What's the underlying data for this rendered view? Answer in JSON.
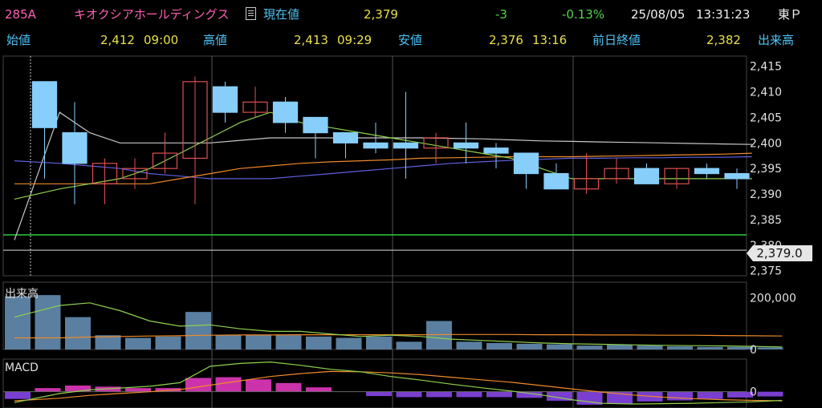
{
  "header": {
    "code": "285A",
    "company": "キオクシアホールディングス",
    "current_label": "現在値",
    "current": "2,379",
    "change": "-3",
    "change_pct": "-0.13%",
    "date": "25/08/05",
    "time": "13:31:23",
    "exchange": "東Ｐ",
    "open_label": "始値",
    "open": "2,412",
    "open_time": "09:00",
    "high_label": "高値",
    "high": "2,413",
    "high_time": "09:29",
    "low_label": "安値",
    "low": "2,376",
    "low_time": "13:16",
    "prev_label": "前日終値",
    "prev": "2,382",
    "volume_label": "出来高"
  },
  "colors": {
    "up": "#e05050",
    "down": "#87cefa",
    "ma_short": "#8fd14f",
    "ma_mid": "#f08a2a",
    "ma_long": "#6060e0",
    "ma_vlong": "#c8c8c8",
    "prev_close": "#2ecc40",
    "volume_bar": "#5a7fa0",
    "macd_pos": "#cc33aa",
    "macd_neg": "#7a3fd0"
  },
  "chart_data": {
    "type": "candlestick",
    "price_label": "2,379.0",
    "ylim": [
      2374,
      2417
    ],
    "price_ticks": [
      {
        "v": 2415,
        "label": "2,415"
      },
      {
        "v": 2410,
        "label": "2,410"
      },
      {
        "v": 2405,
        "label": "2,405"
      },
      {
        "v": 2400,
        "label": "2,400"
      },
      {
        "v": 2395,
        "label": "2,395"
      },
      {
        "v": 2390,
        "label": "2,390"
      },
      {
        "v": 2385,
        "label": "2,385"
      },
      {
        "v": 2380,
        "label": "2,380"
      },
      {
        "v": 2375,
        "label": "2,375"
      }
    ],
    "prev_close": 2382,
    "candles": [
      {
        "o": 2412,
        "h": 2412,
        "l": 2393,
        "c": 2403
      },
      {
        "o": 2402,
        "h": 2408,
        "l": 2388,
        "c": 2396
      },
      {
        "o": 2392,
        "h": 2397,
        "l": 2388,
        "c": 2396
      },
      {
        "o": 2393,
        "h": 2397,
        "l": 2391,
        "c": 2395
      },
      {
        "o": 2395,
        "h": 2402,
        "l": 2394,
        "c": 2398
      },
      {
        "o": 2397,
        "h": 2413,
        "l": 2388,
        "c": 2412
      },
      {
        "o": 2411,
        "h": 2412,
        "l": 2404,
        "c": 2406
      },
      {
        "o": 2406,
        "h": 2411,
        "l": 2405,
        "c": 2408
      },
      {
        "o": 2408,
        "h": 2409,
        "l": 2402,
        "c": 2404
      },
      {
        "o": 2405,
        "h": 2405,
        "l": 2397,
        "c": 2402
      },
      {
        "o": 2402,
        "h": 2402,
        "l": 2397,
        "c": 2400
      },
      {
        "o": 2400,
        "h": 2404,
        "l": 2398,
        "c": 2399
      },
      {
        "o": 2400,
        "h": 2410,
        "l": 2393,
        "c": 2399
      },
      {
        "o": 2399,
        "h": 2402,
        "l": 2396,
        "c": 2401
      },
      {
        "o": 2400,
        "h": 2404,
        "l": 2396,
        "c": 2399
      },
      {
        "o": 2399,
        "h": 2400,
        "l": 2395,
        "c": 2398
      },
      {
        "o": 2398,
        "h": 2398,
        "l": 2391,
        "c": 2394
      },
      {
        "o": 2394,
        "h": 2396,
        "l": 2391,
        "c": 2391
      },
      {
        "o": 2391,
        "h": 2398,
        "l": 2390,
        "c": 2393
      },
      {
        "o": 2393,
        "h": 2397,
        "l": 2392,
        "c": 2395
      },
      {
        "o": 2395,
        "h": 2396,
        "l": 2392,
        "c": 2392
      },
      {
        "o": 2392,
        "h": 2395,
        "l": 2391,
        "c": 2395
      },
      {
        "o": 2395,
        "h": 2396,
        "l": 2393,
        "c": 2394
      },
      {
        "o": 2394,
        "h": 2395,
        "l": 2391,
        "c": 2393
      }
    ],
    "ma_short": [
      2389,
      2391,
      2392,
      2393,
      2395,
      2398,
      2401,
      2404,
      2406,
      2404,
      2403,
      2402,
      2401,
      2400,
      2399,
      2398,
      2397,
      2395,
      2393,
      2393,
      2393,
      2393,
      2393,
      2393,
      2393
    ],
    "ma_mid": [
      2392,
      2392,
      2392,
      2392,
      2392,
      2393,
      2394,
      2395,
      2395.5,
      2396,
      2396.3,
      2396.5,
      2396.7,
      2397,
      2397.1,
      2397.2,
      2397.3,
      2397.3,
      2397.3,
      2397.4,
      2397.5,
      2397.6,
      2397.7,
      2397.8,
      2398
    ],
    "ma_long": [
      2396.5,
      2396,
      2395.5,
      2395,
      2394,
      2393.5,
      2393,
      2393,
      2393,
      2393.5,
      2394,
      2394.5,
      2395,
      2395.5,
      2396,
      2396.3,
      2396.6,
      2396.8,
      2397,
      2397,
      2397.1,
      2397.1,
      2397.2,
      2397.2,
      2397.3
    ],
    "ma_vlong": [
      2381,
      2406,
      2402,
      2400,
      2400,
      2400,
      2400,
      2400.5,
      2401,
      2401,
      2401,
      2401,
      2401,
      2401,
      2400.9,
      2400.8,
      2400.6,
      2400.4,
      2400.3,
      2400.2,
      2400.1,
      2400,
      2399.9,
      2399.8,
      2399.7
    ],
    "volume_ticks": [
      {
        "v": 200000,
        "label": "200,000"
      },
      {
        "v": 0,
        "label": "0"
      }
    ],
    "volume_label": "出来高",
    "volume_max": 260000,
    "volume": [
      205000,
      210000,
      125000,
      55000,
      45000,
      50000,
      145000,
      55000,
      55000,
      55000,
      50000,
      45000,
      50000,
      30000,
      110000,
      30000,
      25000,
      22000,
      20000,
      15000,
      18000,
      15000,
      12000,
      10000,
      10000,
      8000
    ],
    "vol_ma_short": [
      125000,
      170000,
      180000,
      150000,
      110000,
      90000,
      95000,
      80000,
      70000,
      70000,
      60000,
      50000,
      55000,
      50000,
      40000,
      35000,
      30000,
      25000,
      22000,
      20000,
      18000,
      16000,
      15000,
      14000,
      12000,
      10000
    ],
    "vol_ma_long": [
      45000,
      45000,
      48000,
      50000,
      52000,
      53000,
      55000,
      56000,
      56000,
      57000,
      57000,
      57000,
      57000,
      57000,
      58000,
      58000,
      58000,
      57000,
      57000,
      56000,
      56000,
      55000,
      55000,
      54000,
      53000,
      52000
    ],
    "macd_label": "MACD",
    "macd_tick": {
      "v": 0,
      "label": "0"
    },
    "macd_ylim": [
      -4.5,
      9
    ],
    "macd_hist": [
      -2,
      1,
      1.7,
      1.4,
      1,
      1,
      3.8,
      4.0,
      3.4,
      2.4,
      1.2,
      0,
      -1.2,
      -1.5,
      -1.5,
      -1.5,
      -1.5,
      -1.7,
      -2.5,
      -3.6,
      -3.4,
      -2.7,
      -2.4,
      -2.0,
      -1.6,
      -1.3
    ],
    "macd_line": [
      -3,
      -0.5,
      0.5,
      1,
      1.5,
      2.5,
      7,
      7.8,
      8.2,
      7.3,
      6.2,
      5.5,
      4.2,
      3.2,
      2.1,
      1.1,
      0.2,
      -0.9,
      -2.2,
      -3.2,
      -3.4,
      -3.3,
      -3.2,
      -3.0,
      -2.8,
      -2.4
    ],
    "macd_signal": [
      -2.5,
      -1.8,
      -1,
      -0.5,
      0,
      0.6,
      1.8,
      3,
      4.2,
      5,
      5.6,
      5.5,
      5.2,
      4.7,
      4,
      3.3,
      2.6,
      1.7,
      0.8,
      -0.1,
      -0.9,
      -1.5,
      -1.9,
      -2.2,
      -2.4,
      -2.5
    ]
  }
}
